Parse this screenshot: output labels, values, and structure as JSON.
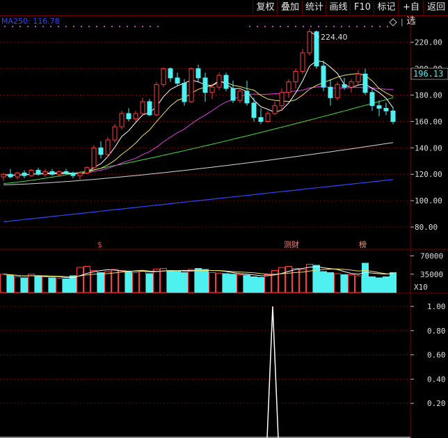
{
  "toolbar": {
    "buttons": [
      "复权",
      "叠加",
      "统计",
      "画线",
      "F10",
      "标记",
      "+自选",
      "返回"
    ]
  },
  "indicator": {
    "ma_label": "MA250: 116.78"
  },
  "price_panel": {
    "max_label": "224.40",
    "current_price": "196.13",
    "y_ticks": [
      "220.00",
      "200.00",
      "180.00",
      "160.00",
      "140.00",
      "120.00",
      "100.00",
      "80.00"
    ],
    "markers": [
      "$",
      "测财",
      "榜"
    ]
  },
  "volume_panel": {
    "y_ticks": [
      "70000",
      "35000"
    ],
    "multiplier": "X10"
  },
  "signal_panel": {
    "y_ticks": [
      "1.00",
      "0.80",
      "0.60",
      "0.40",
      "0.20"
    ]
  },
  "colors": {
    "up": "#ff3a3a",
    "down": "#4ef0f0",
    "ma5": "#ffffff",
    "ma10": "#f0e060",
    "ma20": "#e040e0",
    "ma60": "#40e040",
    "ma120": "#d8d8d8",
    "ma250": "#3344ff",
    "grid": "#7a0000",
    "dots": "#c040c0"
  },
  "chart_data": {
    "type": "candlestick",
    "ylim": [
      70,
      232
    ],
    "candles": [
      [
        118,
        121,
        115,
        120
      ],
      [
        120,
        124,
        117,
        118
      ],
      [
        118,
        122,
        116,
        121
      ],
      [
        121,
        123,
        117,
        119
      ],
      [
        119,
        124,
        118,
        123
      ],
      [
        123,
        125,
        119,
        120
      ],
      [
        120,
        124,
        118,
        122
      ],
      [
        122,
        124,
        119,
        120
      ],
      [
        120,
        123,
        118,
        122
      ],
      [
        122,
        124,
        120,
        121
      ],
      [
        121,
        122,
        117,
        119
      ],
      [
        119,
        122,
        116,
        121
      ],
      [
        121,
        126,
        120,
        125
      ],
      [
        125,
        142,
        124,
        140
      ],
      [
        140,
        145,
        132,
        135
      ],
      [
        135,
        148,
        133,
        146
      ],
      [
        146,
        158,
        144,
        156
      ],
      [
        156,
        168,
        154,
        166
      ],
      [
        166,
        170,
        160,
        162
      ],
      [
        162,
        168,
        160,
        166
      ],
      [
        166,
        178,
        165,
        175
      ],
      [
        175,
        177,
        164,
        165
      ],
      [
        165,
        190,
        164,
        188
      ],
      [
        188,
        201,
        186,
        200
      ],
      [
        200,
        201,
        190,
        193
      ],
      [
        193,
        197,
        187,
        189
      ],
      [
        189,
        192,
        172,
        175
      ],
      [
        175,
        201,
        174,
        200
      ],
      [
        200,
        203,
        190,
        193
      ],
      [
        193,
        197,
        175,
        182
      ],
      [
        182,
        189,
        177,
        186
      ],
      [
        186,
        197,
        184,
        195
      ],
      [
        195,
        197,
        183,
        185
      ],
      [
        185,
        191,
        174,
        176
      ],
      [
        176,
        185,
        174,
        183
      ],
      [
        183,
        191,
        172,
        174
      ],
      [
        174,
        178,
        160,
        163
      ],
      [
        163,
        170,
        158,
        160
      ],
      [
        160,
        168,
        159,
        166
      ],
      [
        166,
        175,
        165,
        172
      ],
      [
        172,
        185,
        168,
        182
      ],
      [
        182,
        192,
        178,
        190
      ],
      [
        190,
        200,
        185,
        198
      ],
      [
        198,
        215,
        196,
        212
      ],
      [
        212,
        230,
        210,
        228
      ],
      [
        228,
        229,
        200,
        202
      ],
      [
        202,
        206,
        183,
        186
      ],
      [
        186,
        192,
        172,
        178
      ],
      [
        178,
        190,
        176,
        188
      ],
      [
        188,
        193,
        184,
        186
      ],
      [
        186,
        192,
        182,
        190
      ],
      [
        190,
        199,
        188,
        196
      ],
      [
        196,
        200,
        180,
        182
      ],
      [
        182,
        185,
        168,
        172
      ],
      [
        172,
        176,
        164,
        170
      ],
      [
        170,
        174,
        165,
        168
      ],
      [
        168,
        171,
        158,
        160
      ]
    ],
    "volume": [
      35,
      33,
      30,
      28,
      35,
      32,
      30,
      28,
      27,
      26,
      32,
      48,
      50,
      42,
      38,
      40,
      44,
      42,
      40,
      38,
      41,
      36,
      45,
      46,
      42,
      40,
      38,
      44,
      46,
      44,
      38,
      37,
      36,
      35,
      34,
      33,
      30,
      29,
      34,
      42,
      48,
      50,
      46,
      44,
      54,
      52,
      40,
      38,
      36,
      34,
      34,
      32,
      56,
      30,
      28,
      30,
      38
    ]
  }
}
